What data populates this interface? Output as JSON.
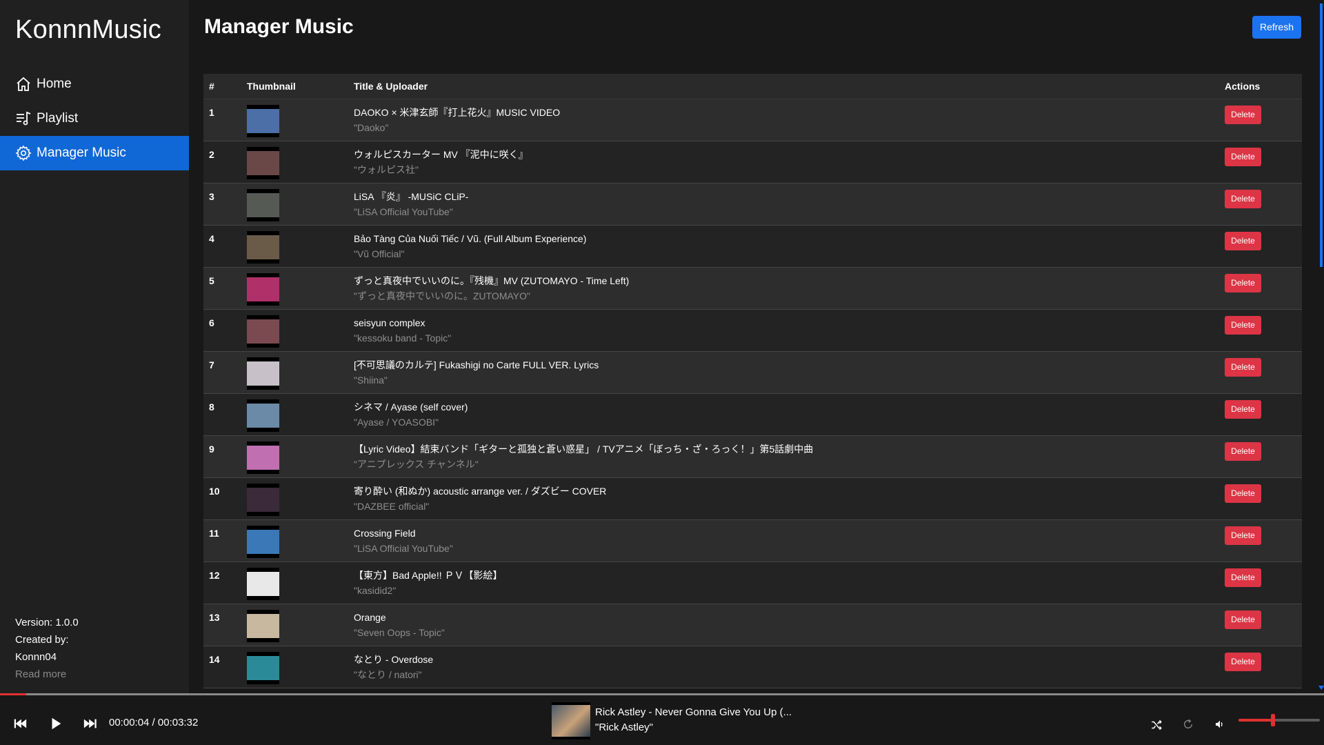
{
  "app": {
    "brand": "KonnnMusic"
  },
  "sidebar": {
    "items": [
      {
        "label": "Home",
        "icon": "home-icon",
        "active": false
      },
      {
        "label": "Playlist",
        "icon": "playlist-icon",
        "active": false
      },
      {
        "label": "Manager Music",
        "icon": "gear-icon",
        "active": true
      }
    ],
    "footer": {
      "version": "Version: 1.0.0",
      "created_by": "Created by:",
      "author": "Konnn04",
      "read_more": "Read more"
    }
  },
  "main": {
    "title": "Manager Music",
    "refresh_label": "Refresh",
    "table": {
      "headers": {
        "num": "#",
        "thumb": "Thumbnail",
        "title": "Title & Uploader",
        "actions": "Actions"
      },
      "delete_label": "Delete",
      "rows": [
        {
          "num": "1",
          "title": "DAOKO × 米津玄師『打上花火』MUSIC VIDEO",
          "uploader": "\"Daoko\"",
          "thumb_color": "#4c6fa8"
        },
        {
          "num": "2",
          "title": "ウォルピスカーター MV 『泥中に咲く』",
          "uploader": "\"ウォルピス社\"",
          "thumb_color": "#6b4848"
        },
        {
          "num": "3",
          "title": "LiSA 『炎』 -MUSiC CLiP-",
          "uploader": "\"LiSA Official YouTube\"",
          "thumb_color": "#555a55"
        },
        {
          "num": "4",
          "title": "Bảo Tàng Của Nuối Tiếc / Vũ. (Full Album Experience)",
          "uploader": "\"Vũ Official\"",
          "thumb_color": "#6a5a48"
        },
        {
          "num": "5",
          "title": "ずっと真夜中でいいのに。『残機』MV (ZUTOMAYO - Time Left)",
          "uploader": "\"ずっと真夜中でいいのに。ZUTOMAYO\"",
          "thumb_color": "#b0306a"
        },
        {
          "num": "6",
          "title": "seisyun complex",
          "uploader": "\"kessoku band - Topic\"",
          "thumb_color": "#7a4a50"
        },
        {
          "num": "7",
          "title": "[不可思議のカルテ] Fukashigi no Carte FULL VER. Lyrics",
          "uploader": "\"Shiina\"",
          "thumb_color": "#c8c0c8"
        },
        {
          "num": "8",
          "title": "シネマ / Ayase (self cover)",
          "uploader": "\"Ayase / YOASOBI\"",
          "thumb_color": "#6a8aa8"
        },
        {
          "num": "9",
          "title": "【Lyric Video】結束バンド「ギターと孤独と蒼い惑星」 / TVアニメ「ぼっち・ざ・ろっく！」第5話劇中曲",
          "uploader": "\"アニプレックス チャンネル\"",
          "thumb_color": "#c070b0"
        },
        {
          "num": "10",
          "title": "寄り酔い (和ぬか) acoustic arrange ver. / ダズビー COVER",
          "uploader": "\"DAZBEE official\"",
          "thumb_color": "#3a2a3a"
        },
        {
          "num": "11",
          "title": "Crossing Field",
          "uploader": "\"LiSA Official YouTube\"",
          "thumb_color": "#3a78b8"
        },
        {
          "num": "12",
          "title": "【東方】Bad Apple!! ＰＶ【影絵】",
          "uploader": "\"kasidid2\"",
          "thumb_color": "#e8e8e8"
        },
        {
          "num": "13",
          "title": "Orange",
          "uploader": "\"Seven Oops - Topic\"",
          "thumb_color": "#c8b8a0"
        },
        {
          "num": "14",
          "title": "なとり - Overdose",
          "uploader": "\"なとり / natori\"",
          "thumb_color": "#2a8a98"
        }
      ]
    }
  },
  "player": {
    "time": "00:00:04 / 00:03:32",
    "progress": 0.02,
    "volume": 0.42,
    "now_playing": {
      "title": "Rick Astley - Never Gonna Give You Up (...",
      "artist": "\"Rick Astley\""
    },
    "controls": [
      "previous-icon",
      "play-icon",
      "next-icon",
      "shuffle-icon",
      "repeat-icon",
      "volume-icon"
    ]
  },
  "colors": {
    "accent": "#1b73f0",
    "danger": "#dc3545",
    "progress": "#e03131"
  }
}
